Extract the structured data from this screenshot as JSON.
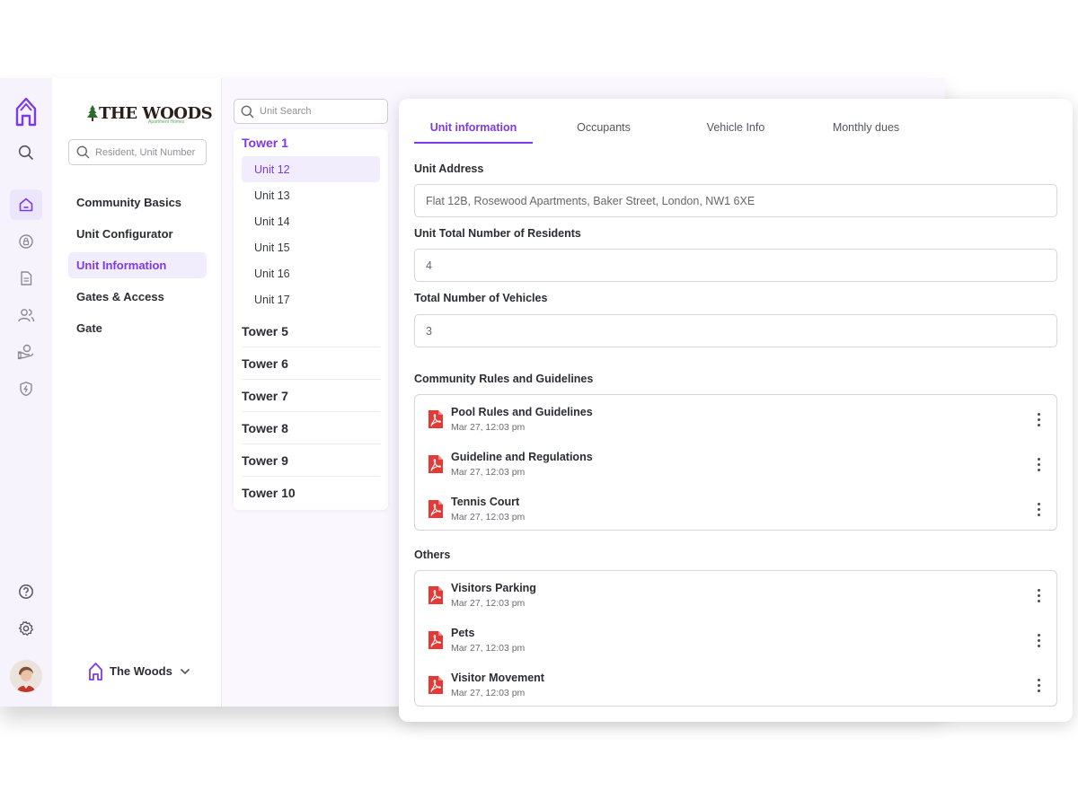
{
  "brand": {
    "name": "THE WOODS",
    "tagline": "Apartment Homes"
  },
  "rail": {
    "top_icons": [
      "home-outline-icon",
      "search-icon"
    ],
    "nav_icons": [
      "home-icon",
      "lock-icon",
      "document-icon",
      "users-icon",
      "hand-coin-icon",
      "shield-bolt-icon"
    ],
    "bottom_icons": [
      "help-icon",
      "settings-icon"
    ]
  },
  "sidebar": {
    "search_placeholder": "Resident, Unit Number",
    "items": [
      {
        "label": "Community Basics"
      },
      {
        "label": "Unit Configurator"
      },
      {
        "label": "Unit Information"
      },
      {
        "label": "Gates & Access"
      },
      {
        "label": "Gate"
      }
    ],
    "active_item": "Unit Information",
    "community": "The Woods"
  },
  "towers": {
    "search_placeholder": "Unit Search",
    "expanded": "Tower 1",
    "units": [
      "Unit 12",
      "Unit 13",
      "Unit 14",
      "Unit 15",
      "Unit 16",
      "Unit 17"
    ],
    "active_unit": "Unit 12",
    "others": [
      "Tower 5",
      "Tower 6",
      "Tower 7",
      "Tower 8",
      "Tower 9",
      "Tower 10"
    ]
  },
  "tabs": [
    {
      "label": "Unit information"
    },
    {
      "label": "Occupants"
    },
    {
      "label": "Vehicle Info"
    },
    {
      "label": "Monthly dues"
    }
  ],
  "active_tab": "Unit information",
  "fields": [
    {
      "label": "Unit Address",
      "value": "Flat 12B, Rosewood Apartments, Baker Street, London, NW1 6XE"
    },
    {
      "label": "Unit Total Number of Residents",
      "value": "4"
    },
    {
      "label": "Total Number of Vehicles",
      "value": "3"
    }
  ],
  "rules": {
    "heading": "Community Rules and Guidelines",
    "docs": [
      {
        "title": "Pool Rules and Guidelines",
        "time": "Mar 27, 12:03 pm"
      },
      {
        "title": "Guideline and Regulations",
        "time": "Mar 27, 12:03 pm"
      },
      {
        "title": "Tennis Court",
        "time": "Mar 27, 12:03 pm"
      }
    ]
  },
  "others": {
    "heading": "Others",
    "docs": [
      {
        "title": "Visitors Parking",
        "time": "Mar 27, 12:03 pm"
      },
      {
        "title": "Pets",
        "time": "Mar 27, 12:03 pm"
      },
      {
        "title": "Visitor Movement",
        "time": "Mar 27, 12:03 pm"
      }
    ]
  },
  "colors": {
    "accent": "#7c3aed",
    "pdf": "#e53935",
    "rail": "#f6f3fd"
  }
}
